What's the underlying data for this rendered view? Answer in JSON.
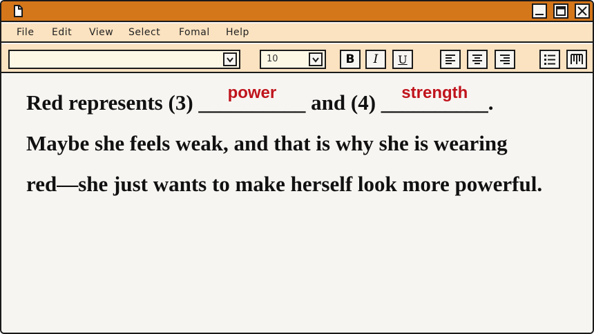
{
  "menu": [
    "File",
    "Edit",
    "View",
    "Select",
    "Fomal",
    "Help"
  ],
  "toolbar": {
    "font_name": "",
    "font_size": "10",
    "bold_label": "B",
    "italic_label": "I",
    "underline_label": "U"
  },
  "document": {
    "line1_a": "Red represents (3)",
    "blank1": "__________",
    "answer1": "power",
    "line1_b": "and (4)",
    "blank2": "__________",
    "answer2": "strength",
    "line1_end": ".",
    "line2": "Maybe she feels weak, and that is why she is wearing",
    "line3": "red—she just wants to make herself look more powerful."
  },
  "colors": {
    "titlebar": "#d4761a",
    "menubar": "#fbe2c0",
    "page": "#f7f5f2",
    "answer": "#c0141c"
  }
}
